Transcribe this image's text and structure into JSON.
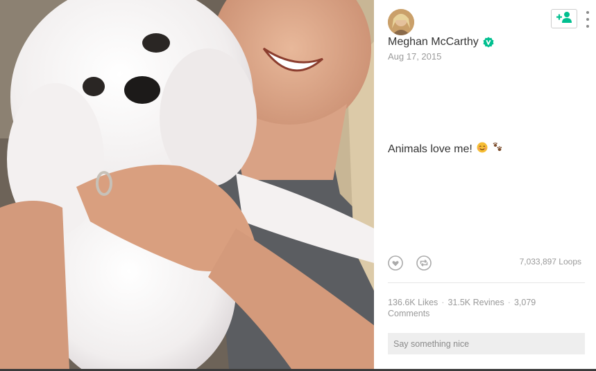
{
  "post": {
    "author_name": "Meghan McCarthy",
    "date": "Aug 17, 2015",
    "caption": "Animals love me!",
    "caption_emojis": [
      "smiling-face-emoji",
      "paw-prints-emoji"
    ]
  },
  "stats": {
    "loops": "7,033,897 Loops",
    "likes": "136.6K Likes",
    "revines": "31.5K Revines",
    "comments": "3,079 Comments"
  },
  "comment_input": {
    "placeholder": "Say something nice",
    "value": ""
  },
  "icons": {
    "follow": "add-person-icon",
    "more": "more-vertical-icon",
    "like": "heart-icon",
    "revine": "revine-icon",
    "verified": "verified-badge-icon"
  },
  "colors": {
    "brand_green": "#00bf8f",
    "text_dark": "#333333",
    "text_muted": "#999999",
    "input_bg": "#eeeeee"
  }
}
